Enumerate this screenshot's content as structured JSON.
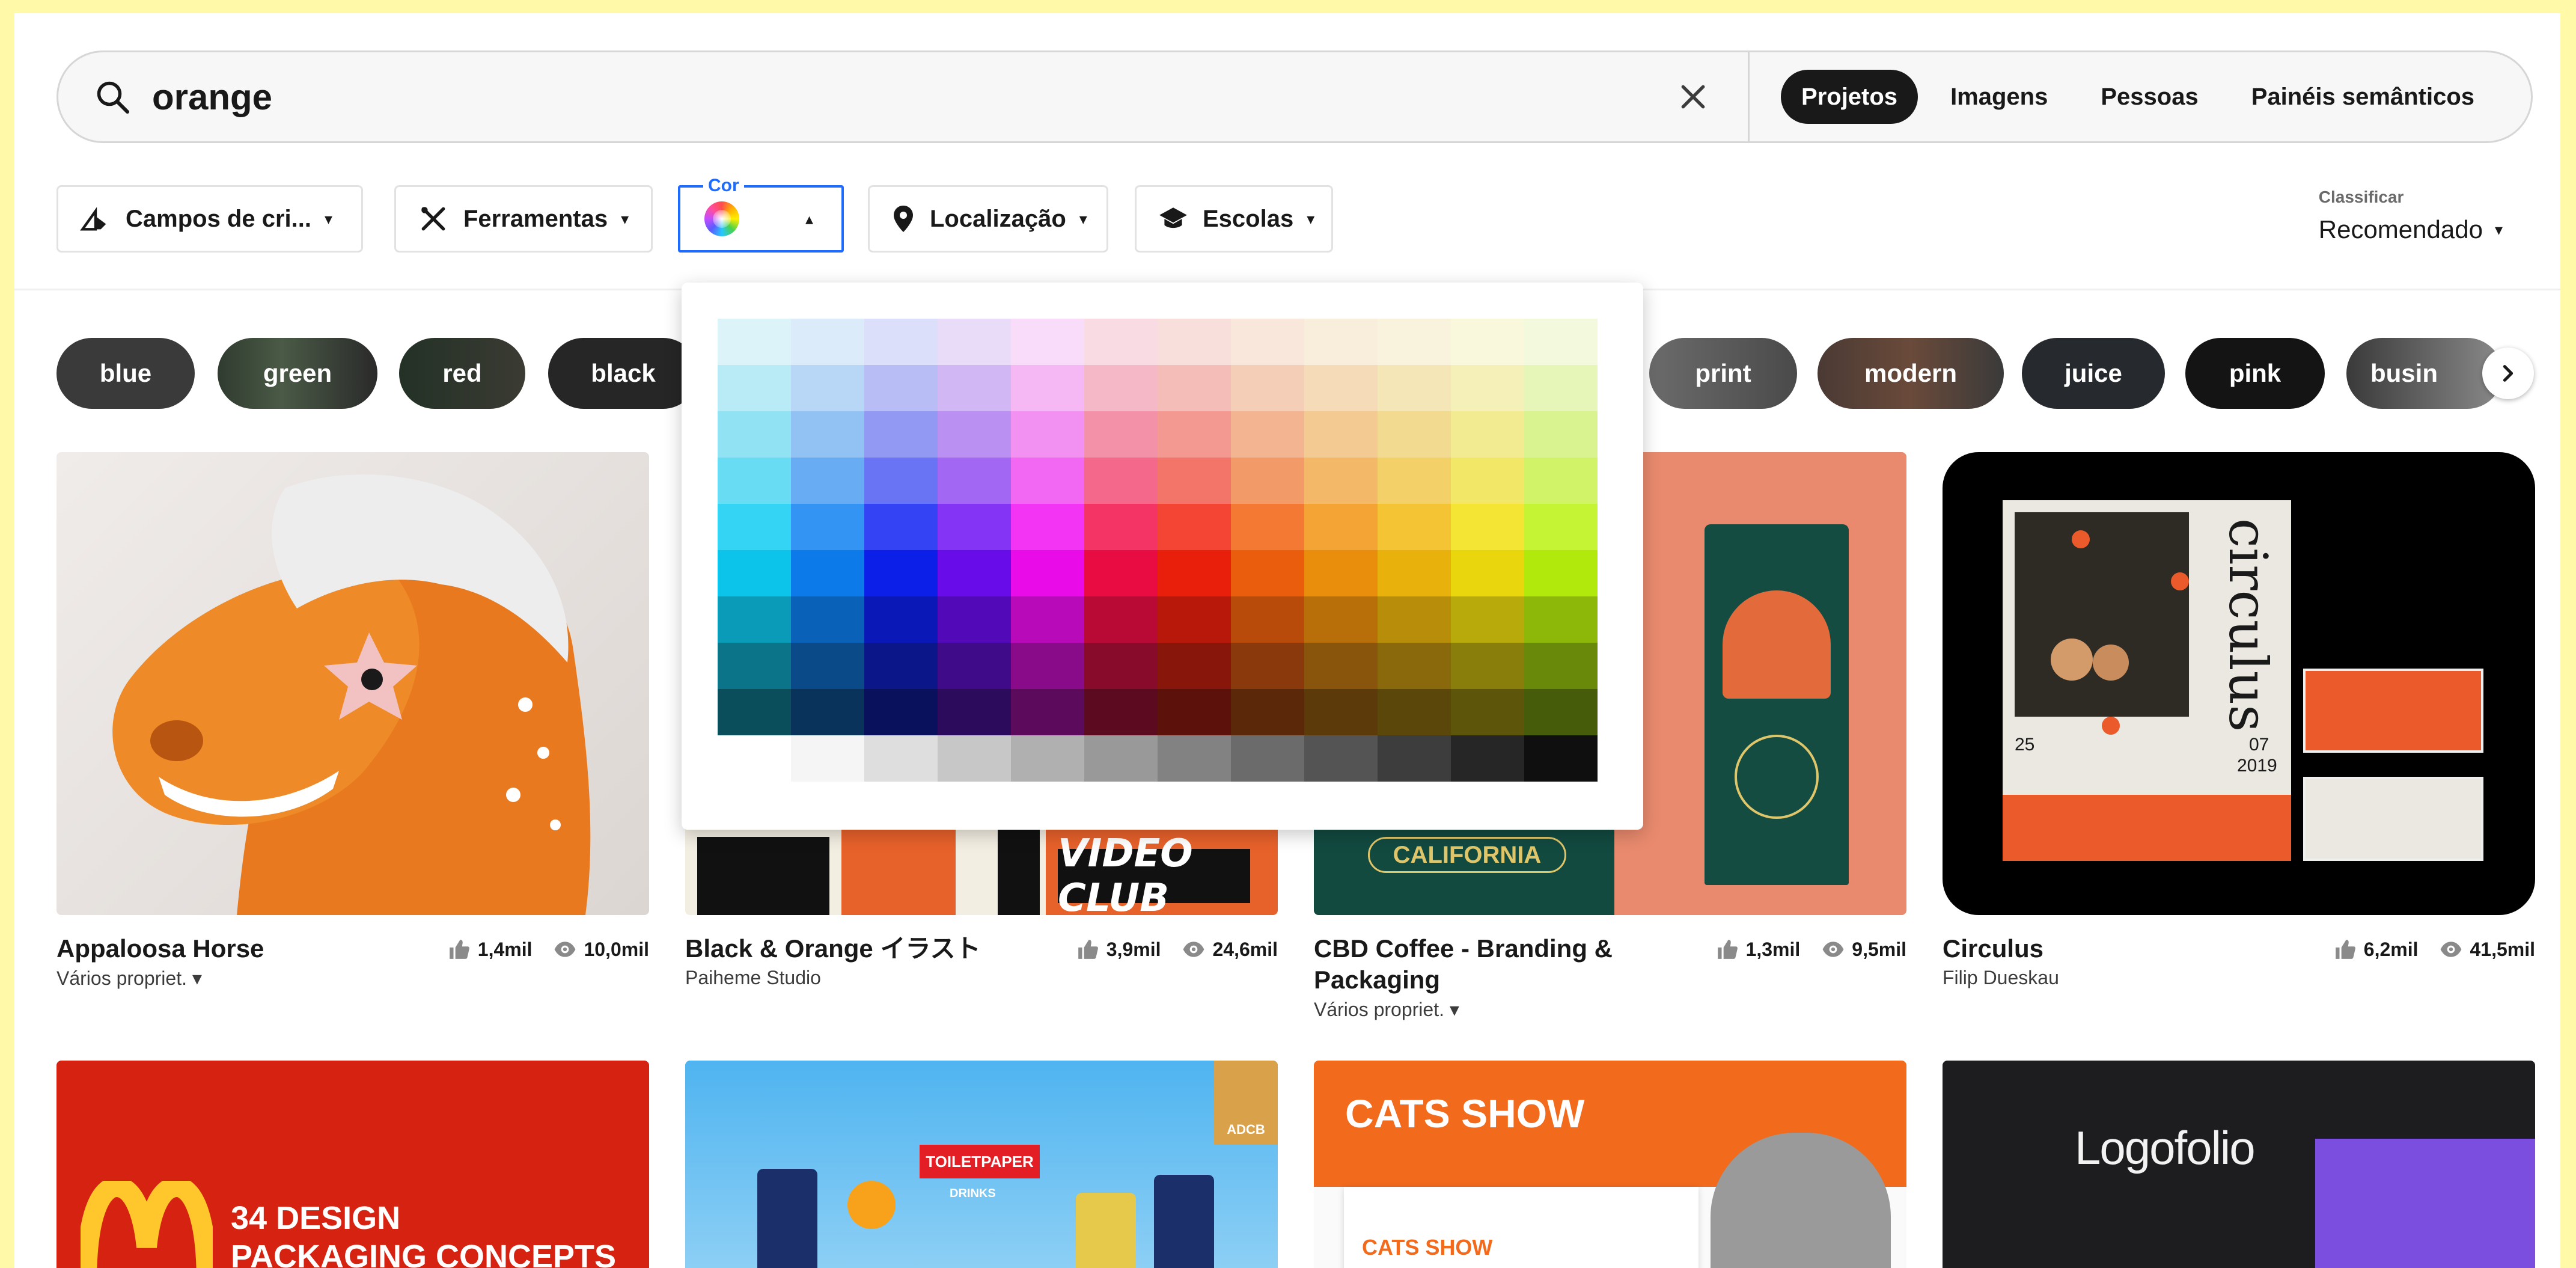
{
  "search": {
    "query": "orange",
    "types": [
      "Projetos",
      "Imagens",
      "Pessoas",
      "Painéis semânticos"
    ],
    "active_type": "Projetos"
  },
  "filters": {
    "campos": "Campos de cri...",
    "ferramentas": "Ferramentas",
    "cor_legend": "Cor",
    "localizacao": "Localização",
    "escolas": "Escolas"
  },
  "sort": {
    "label": "Classificar",
    "value": "Recomendado"
  },
  "tags": [
    "blue",
    "green",
    "red",
    "black",
    "print",
    "modern",
    "juice",
    "pink",
    "busin"
  ],
  "projects": [
    {
      "title": "Appaloosa Horse",
      "owner": "Vários propriet.",
      "owner_dropdown": true,
      "likes": "1,4mil",
      "views": "10,0mil"
    },
    {
      "title": "Black & Orange イラスト",
      "owner": "Paiheme Studio",
      "owner_dropdown": false,
      "likes": "3,9mil",
      "views": "24,6mil"
    },
    {
      "title": "CBD Coffee - Branding & Packaging",
      "owner": "Vários propriet.",
      "owner_dropdown": true,
      "likes": "1,3mil",
      "views": "9,5mil"
    },
    {
      "title": "Circulus",
      "owner": "Filip Dueskau",
      "owner_dropdown": false,
      "likes": "6,2mil",
      "views": "41,5mil"
    }
  ],
  "thumb_text": {
    "video_club": "VIDEO CLUB",
    "california": "CALIFORNIA",
    "circulus": "circulus",
    "c_day": "25",
    "c_month": "07",
    "c_year": "2019",
    "mc_line1": "34 DESIGN",
    "mc_line2": "PACKAGING CONCEPTS",
    "toiletpaper": "TOILETPAPER",
    "drinks": "DRINKS",
    "cats1": "CATS SHOW",
    "cats2": "CATS SHOW",
    "logofolio": "Logofolio",
    "adc": "ADCB"
  },
  "colors": {
    "accent": "#1d6bff",
    "text": "#191919",
    "page_bg": "#fff9a8"
  }
}
